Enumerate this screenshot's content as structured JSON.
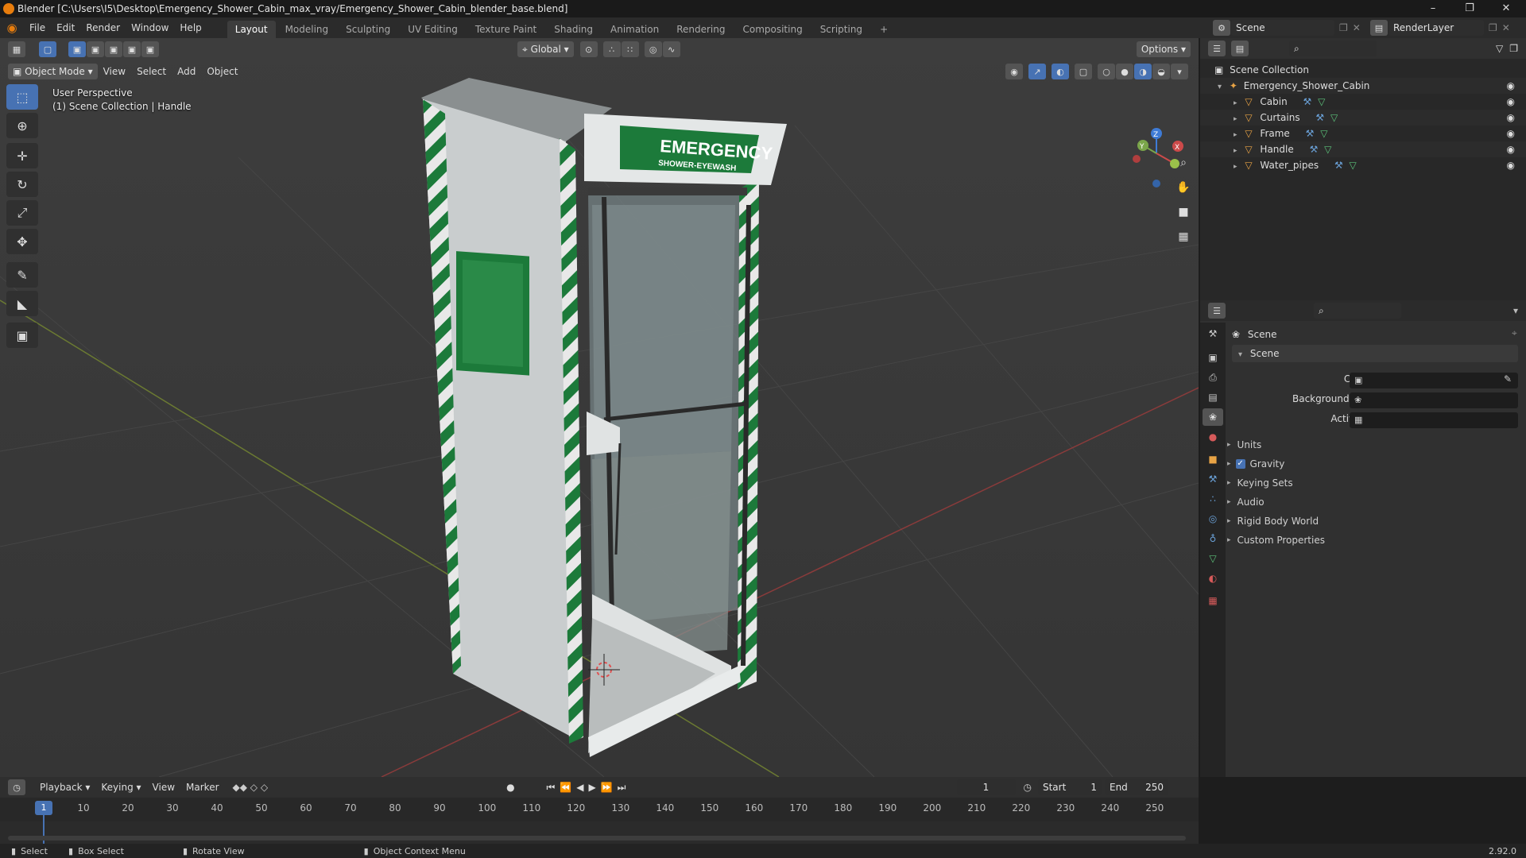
{
  "window": {
    "title": "Blender [C:\\Users\\I5\\Desktop\\Emergency_Shower_Cabin_max_vray/Emergency_Shower_Cabin_blender_base.blend]"
  },
  "menu": [
    "File",
    "Edit",
    "Render",
    "Window",
    "Help"
  ],
  "workspaces": [
    "Layout",
    "Modeling",
    "Sculpting",
    "UV Editing",
    "Texture Paint",
    "Shading",
    "Animation",
    "Rendering",
    "Compositing",
    "Scripting"
  ],
  "active_workspace": "Layout",
  "scene_selector": "Scene",
  "renderlayer_selector": "RenderLayer",
  "viewport": {
    "mode": "Object Mode",
    "menus": [
      "View",
      "Select",
      "Add",
      "Object"
    ],
    "transform_orientation": "Global",
    "options_label": "Options",
    "perspective_label": "User Perspective",
    "collection_label": "(1) Scene Collection | Handle",
    "sign_big": "EMERGENCY",
    "sign_small": "SHOWER-EYEWASH"
  },
  "outliner": {
    "root": "Scene Collection",
    "collection": "Emergency_Shower_Cabin",
    "objects": [
      "Cabin",
      "Curtains",
      "Frame",
      "Handle",
      "Water_pipes"
    ]
  },
  "properties": {
    "header": "Scene",
    "panel": "Scene",
    "fields": [
      {
        "label": "Camera",
        "value": ""
      },
      {
        "label": "Background Scene",
        "value": ""
      },
      {
        "label": "Active Clip",
        "value": ""
      }
    ],
    "sections": [
      "Units",
      "Gravity",
      "Keying Sets",
      "Audio",
      "Rigid Body World",
      "Custom Properties"
    ],
    "gravity_checked": true
  },
  "timeline": {
    "menus": [
      "Playback",
      "Keying",
      "View",
      "Marker"
    ],
    "current_frame": "1",
    "start_label": "Start",
    "start": "1",
    "end_label": "End",
    "end": "250",
    "frames": [
      "1",
      "10",
      "20",
      "30",
      "40",
      "50",
      "60",
      "70",
      "80",
      "90",
      "100",
      "110",
      "120",
      "130",
      "140",
      "150",
      "160",
      "170",
      "180",
      "190",
      "200",
      "210",
      "220",
      "230",
      "240",
      "250"
    ]
  },
  "statusbar": {
    "select": "Select",
    "box_select": "Box Select",
    "rotate_view": "Rotate View",
    "context_menu": "Object Context Menu",
    "version": "2.92.0"
  },
  "colors": {
    "accent": "#4772b3",
    "sign_green": "#1c7a3a",
    "object_orange": "#e8a345"
  }
}
